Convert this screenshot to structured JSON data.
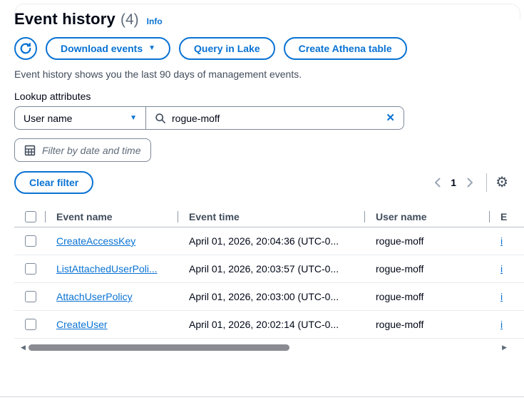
{
  "header": {
    "title": "Event history",
    "count": "(4)",
    "info_label": "Info"
  },
  "toolbar": {
    "download_label": "Download events",
    "query_lake_label": "Query in Lake",
    "athena_label": "Create Athena table"
  },
  "description": "Event history shows you the last 90 days of management events.",
  "filters": {
    "lookup_label": "Lookup attributes",
    "attribute_selected": "User name",
    "search_value": "rogue-moff",
    "date_placeholder": "Filter by date and time",
    "clear_label": "Clear filter"
  },
  "pagination": {
    "current_page": "1"
  },
  "table": {
    "columns": {
      "event_name": "Event name",
      "event_time": "Event time",
      "user_name": "User name",
      "event_source": "E"
    },
    "rows": [
      {
        "event_name": "CreateAccessKey",
        "event_time": "April 01, 2026, 20:04:36 (UTC-0...",
        "user_name": "rogue-moff",
        "event_source": "i"
      },
      {
        "event_name": "ListAttachedUserPoli...",
        "event_time": "April 01, 2026, 20:03:57 (UTC-0...",
        "user_name": "rogue-moff",
        "event_source": "i"
      },
      {
        "event_name": "AttachUserPolicy",
        "event_time": "April 01, 2026, 20:03:00 (UTC-0...",
        "user_name": "rogue-moff",
        "event_source": "i"
      },
      {
        "event_name": "CreateUser",
        "event_time": "April 01, 2026, 20:02:14 (UTC-0...",
        "user_name": "rogue-moff",
        "event_source": "i"
      }
    ]
  },
  "icons": {
    "refresh": "circular-refresh-arrow",
    "download_caret": "▼",
    "select_caret": "▼",
    "search": "magnifier",
    "clear_x": "✕",
    "calendar": "calendar-grid",
    "gear": "⚙",
    "scroll_left": "◀",
    "scroll_right": "▶"
  },
  "colors": {
    "accent_blue": "#0972d3",
    "text_dark": "#000716",
    "text_secondary": "#414d5c",
    "border_gray": "#7d8998",
    "header_divider": "#b6bec9",
    "row_divider": "#e9ebed",
    "scroll_thumb": "#8a8a92"
  }
}
